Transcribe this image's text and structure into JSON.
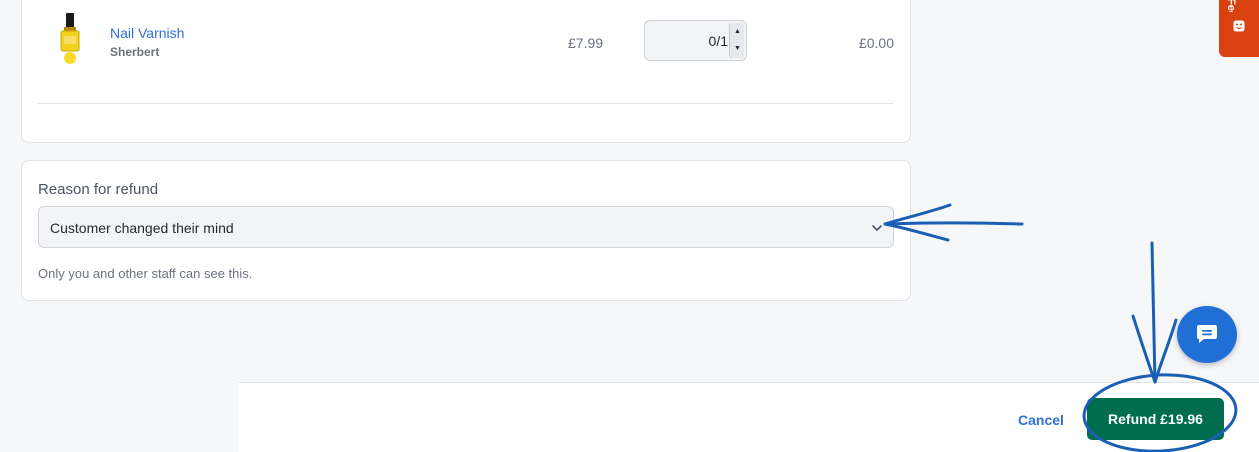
{
  "product": {
    "name": "Nail Varnish",
    "variant": "Sherbert",
    "price": "£7.99",
    "quantity": "0/1",
    "total": "£0.00"
  },
  "reason": {
    "label": "Reason for refund",
    "selected": "Customer changed their mind",
    "help_text": "Only you and other staff can see this."
  },
  "footer": {
    "cancel_label": "Cancel",
    "refund_label": "Refund £19.96"
  },
  "feedback_tab": {
    "label": "Feedback"
  },
  "colors": {
    "link": "#2f6fdb",
    "refund_button": "#006d4e",
    "feedback_tab": "#d9410f",
    "chat_button": "#1f6fd6",
    "annotation_ink": "#1a5fb4"
  }
}
